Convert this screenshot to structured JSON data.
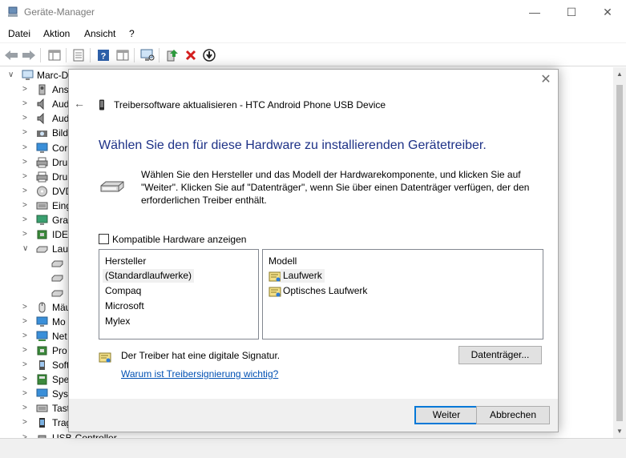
{
  "window": {
    "title": "Geräte-Manager",
    "controls": {
      "minimize": "—",
      "maximize": "☐",
      "close": "✕"
    }
  },
  "menu": [
    "Datei",
    "Aktion",
    "Ansicht",
    "?"
  ],
  "tree": {
    "root": "Marc-D",
    "items": [
      {
        "label": "Ans",
        "icon": "audio-input-icon",
        "expanded": false
      },
      {
        "label": "Aud",
        "icon": "speaker-icon",
        "expanded": false
      },
      {
        "label": "Aud",
        "icon": "speaker-icon",
        "expanded": false
      },
      {
        "label": "Bild",
        "icon": "camera-icon",
        "expanded": false
      },
      {
        "label": "Cor",
        "icon": "monitor-icon",
        "expanded": false
      },
      {
        "label": "Dru",
        "icon": "printer-icon",
        "expanded": false
      },
      {
        "label": "Dru",
        "icon": "printer-icon",
        "expanded": false
      },
      {
        "label": "DVD",
        "icon": "dvd-icon",
        "expanded": false
      },
      {
        "label": "Eing",
        "icon": "keyboard-icon",
        "expanded": false
      },
      {
        "label": "Gra",
        "icon": "display-adapter-icon",
        "expanded": false
      },
      {
        "label": "IDE",
        "icon": "ide-icon",
        "expanded": false
      },
      {
        "label": "Lau",
        "icon": "drive-icon",
        "expanded": true
      },
      {
        "label": "",
        "icon": "drive-icon",
        "child": true,
        "selected": true
      },
      {
        "label": "",
        "icon": "drive-icon",
        "child": true
      },
      {
        "label": "",
        "icon": "drive-icon",
        "child": true
      },
      {
        "label": "Mäu",
        "icon": "mouse-icon",
        "expanded": false
      },
      {
        "label": "Mo",
        "icon": "monitor-icon",
        "expanded": false
      },
      {
        "label": "Net",
        "icon": "network-icon",
        "expanded": false
      },
      {
        "label": "Pro",
        "icon": "processor-icon",
        "expanded": false
      },
      {
        "label": "Soft",
        "icon": "software-device-icon",
        "expanded": false
      },
      {
        "label": "Spe",
        "icon": "storage-icon",
        "expanded": false
      },
      {
        "label": "Syst",
        "icon": "system-icon",
        "expanded": false
      },
      {
        "label": "Tast",
        "icon": "keyboard-icon",
        "expanded": false
      },
      {
        "label": "Trag",
        "icon": "portable-device-icon",
        "expanded": false
      },
      {
        "label": "USB-Controller",
        "icon": "usb-icon",
        "expanded": false
      }
    ]
  },
  "dialog": {
    "header_title": "Treibersoftware aktualisieren - HTC Android Phone USB Device",
    "heading": "Wählen Sie den für diese Hardware zu installierenden Gerätetreiber.",
    "description": "Wählen Sie den Hersteller und das Modell der Hardwarekomponente, und klicken Sie auf \"Weiter\". Klicken Sie auf \"Datenträger\", wenn Sie über einen Datenträger verfügen, der den erforderlichen Treiber enthält.",
    "compatible_label": "Kompatible Hardware anzeigen",
    "compatible_checked": false,
    "manufacturer_header": "Hersteller",
    "manufacturers": [
      "(Standardlaufwerke)",
      "Compaq",
      "Microsoft",
      "Mylex"
    ],
    "model_header": "Modell",
    "models": [
      "Laufwerk",
      "Optisches Laufwerk"
    ],
    "signature_text": "Der Treiber hat eine digitale Signatur.",
    "signature_link": "Warum ist Treibersignierung wichtig?",
    "disk_button": "Datenträger...",
    "next_button": "Weiter",
    "cancel_button": "Abbrechen",
    "close_glyph": "✕",
    "back_glyph": "←"
  },
  "colors": {
    "heading": "#1e3287",
    "link": "#0050b3",
    "default_button_border": "#0078d7",
    "footer_bg": "#f0f0f0"
  }
}
